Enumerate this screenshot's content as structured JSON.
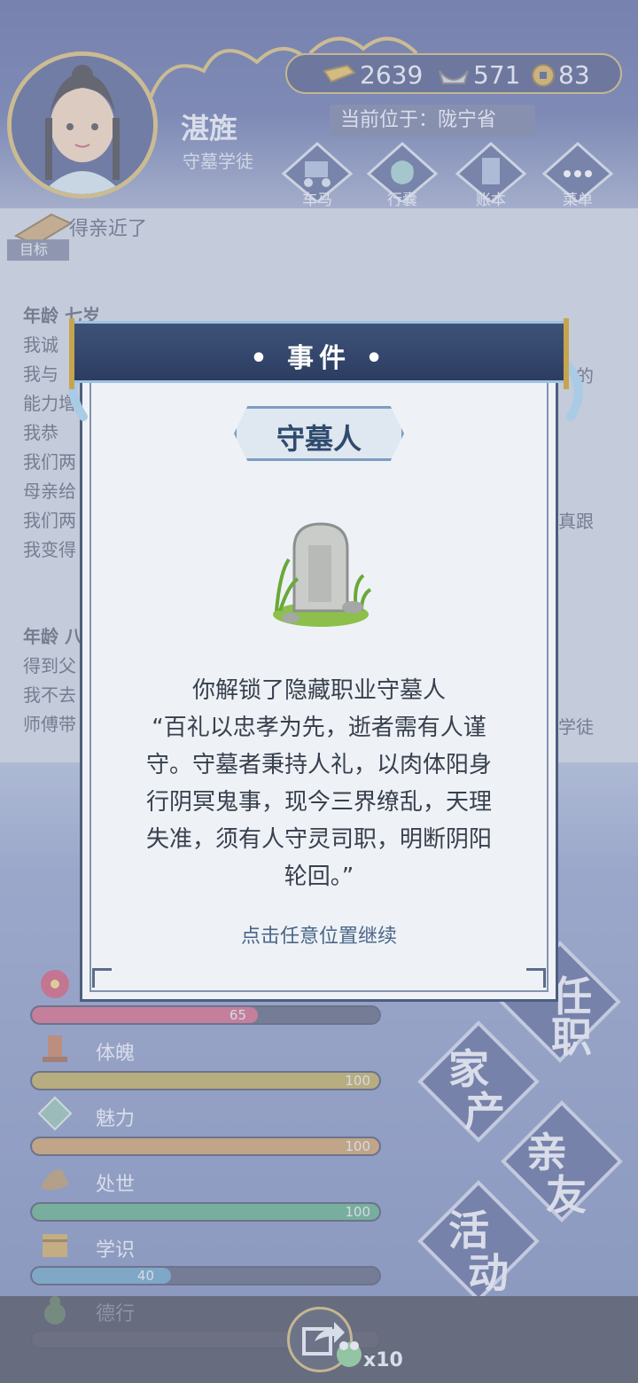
{
  "player": {
    "name": "湛旌",
    "title": "守墓学徒"
  },
  "currency": {
    "gold": "2639",
    "silver": "571",
    "coins": "83"
  },
  "location": "当前位于：陇宁省",
  "nav": [
    {
      "label": "车马",
      "icon": "carriage-icon"
    },
    {
      "label": "行囊",
      "icon": "bag-icon"
    },
    {
      "label": "账本",
      "icon": "ledger-icon"
    },
    {
      "label": "菜单",
      "icon": "menu-dots-icon"
    }
  ],
  "goal": {
    "text": "得亲近了",
    "label": "目标"
  },
  "log": {
    "entry1_heading": "年龄 七岁",
    "entry1_lines": [
      "我诚",
      "我与",
      "能力增",
      "我恭",
      "我们两",
      "母亲给",
      "我们两",
      "我变得"
    ],
    "entry1_right": [
      "的",
      "真跟"
    ],
    "entry2_heading": "年龄 八",
    "entry2_lines": [
      "得到父",
      "我不去",
      "师傅带"
    ],
    "entry2_right": "学徒"
  },
  "stats": [
    {
      "name": "",
      "value": "65",
      "level": 0.65,
      "color": "#c8466a",
      "icon": "flower-icon"
    },
    {
      "name": "体魄",
      "value": "100",
      "level": 1.0,
      "color": "#b39a3b",
      "icon": "statue-icon"
    },
    {
      "name": "魅力",
      "value": "100",
      "level": 1.0,
      "color": "#c18a4a",
      "icon": "mirror-icon"
    },
    {
      "name": "处世",
      "value": "100",
      "level": 1.0,
      "color": "#3f9c6d",
      "icon": "shoe-icon"
    },
    {
      "name": "学识",
      "value": "40",
      "level": 0.4,
      "color": "#4b8fb8",
      "icon": "books-icon"
    },
    {
      "name": "德行",
      "value": "",
      "level": 0.0,
      "color": "#7a6aa0",
      "icon": "gourd-icon"
    }
  ],
  "big_tiles": [
    {
      "chars": [
        "任",
        "职"
      ]
    },
    {
      "chars": [
        "家",
        "产"
      ]
    },
    {
      "chars": [
        "亲",
        "友"
      ]
    },
    {
      "chars": [
        "活",
        "动"
      ]
    }
  ],
  "bottom": {
    "multiplier": "x10"
  },
  "event": {
    "header": "• 事件 •",
    "name": "守墓人",
    "lines": [
      "你解锁了隐藏职业守墓人",
      "“百礼以忠孝为先，逝者需有人谨",
      "守。守墓者秉持人礼，以肉体阳身",
      "行阴冥鬼事，现今三界缭乱，天理",
      "失准，须有人守灵司职，明断阴阳",
      "轮回。”"
    ],
    "continue_hint": "点击任意位置继续"
  }
}
